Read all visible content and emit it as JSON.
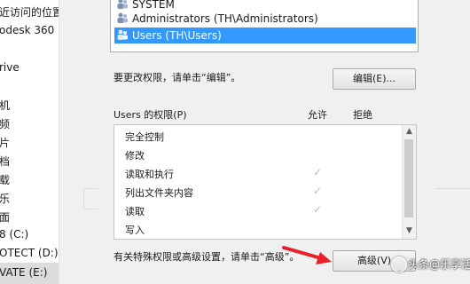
{
  "nav": {
    "items": [
      {
        "label": "近访问的位置"
      },
      {
        "label": "odesk 360"
      },
      {
        "label": "rive"
      },
      {
        "label": "机"
      },
      {
        "label": "频"
      },
      {
        "label": "片"
      },
      {
        "label": "档"
      },
      {
        "label": "载"
      },
      {
        "label": "乐"
      },
      {
        "label": "面"
      },
      {
        "label": "8 (C:)"
      },
      {
        "label": "OTECT (D:)"
      },
      {
        "label": "VATE (E:)"
      }
    ]
  },
  "groups": {
    "items": [
      {
        "label": "SYSTEM",
        "icon": "group-icon"
      },
      {
        "label": "Administrators (TH\\Administrators)",
        "icon": "group-icon"
      },
      {
        "label": "Users (TH\\Users)",
        "icon": "group-icon"
      }
    ]
  },
  "edit_prompt": "要更改权限，请单击“编辑”。",
  "edit_button": "编辑(E)...",
  "perm_header": {
    "title": "Users 的权限(P)",
    "allow": "允许",
    "deny": "拒绝"
  },
  "permissions": [
    {
      "label": "完全控制",
      "allow": false
    },
    {
      "label": "修改",
      "allow": false
    },
    {
      "label": "读取和执行",
      "allow": true
    },
    {
      "label": "列出文件夹内容",
      "allow": true
    },
    {
      "label": "读取",
      "allow": true
    },
    {
      "label": "写入",
      "allow": false
    }
  ],
  "check_glyph": "✓",
  "advanced_prompt": "有关特殊权限或高级设置，请单击“高级”。",
  "advanced_button": "高级(V)",
  "watermark": "头条@乐享活",
  "colors": {
    "selection": "#3399ff",
    "arrow": "#e8202a"
  }
}
